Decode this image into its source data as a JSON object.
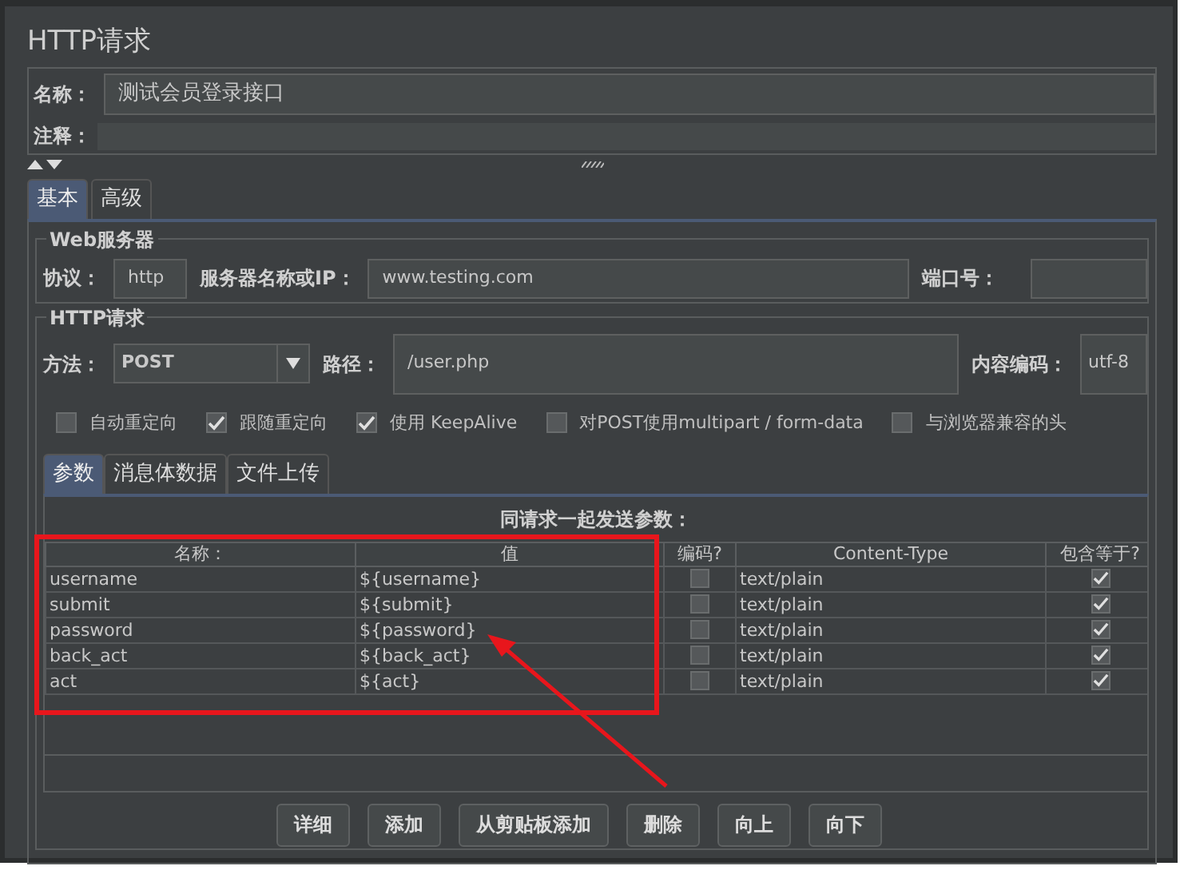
{
  "title": "HTTP请求",
  "name_field": {
    "label": "名称：",
    "value": "测试会员登录接口"
  },
  "comment_field": {
    "label": "注释："
  },
  "tabs": [
    {
      "label": "基本",
      "selected": true
    },
    {
      "label": "高级",
      "selected": false
    }
  ],
  "web_server": {
    "legend": "Web服务器",
    "protocol_label": "协议：",
    "protocol": "http",
    "server_label": "服务器名称或IP：",
    "server": "www.testing.com",
    "port_label": "端口号："
  },
  "http_request": {
    "legend": "HTTP请求",
    "method_label": "方法：",
    "method": "POST",
    "path_label": "路径：",
    "path": "/user.php",
    "encoding_label": "内容编码：",
    "encoding": "utf-8",
    "options": [
      {
        "label": "自动重定向",
        "checked": false
      },
      {
        "label": "跟随重定向",
        "checked": true
      },
      {
        "label": "使用 KeepAlive",
        "checked": true
      },
      {
        "label": "对POST使用multipart / form-data",
        "checked": false
      },
      {
        "label": "与浏览器兼容的头",
        "checked": false
      }
    ]
  },
  "sub_tabs": [
    {
      "label": "参数",
      "selected": true
    },
    {
      "label": "消息体数据",
      "selected": false
    },
    {
      "label": "文件上传",
      "selected": false
    }
  ],
  "params": {
    "title": "同请求一起发送参数：",
    "columns": [
      "名称：",
      "值",
      "编码?",
      "Content-Type",
      "包含等于?"
    ],
    "rows": [
      {
        "name": "username",
        "value": "${username}",
        "encode": false,
        "content_type": "text/plain",
        "include_equals": true
      },
      {
        "name": "submit",
        "value": "${submit}",
        "encode": false,
        "content_type": "text/plain",
        "include_equals": true
      },
      {
        "name": "password",
        "value": "${password}",
        "encode": false,
        "content_type": "text/plain",
        "include_equals": true
      },
      {
        "name": "back_act",
        "value": "${back_act}",
        "encode": false,
        "content_type": "text/plain",
        "include_equals": true
      },
      {
        "name": "act",
        "value": "${act}",
        "encode": false,
        "content_type": "text/plain",
        "include_equals": true
      }
    ]
  },
  "buttons": [
    "详细",
    "添加",
    "从剪贴板添加",
    "删除",
    "向上",
    "向下"
  ]
}
